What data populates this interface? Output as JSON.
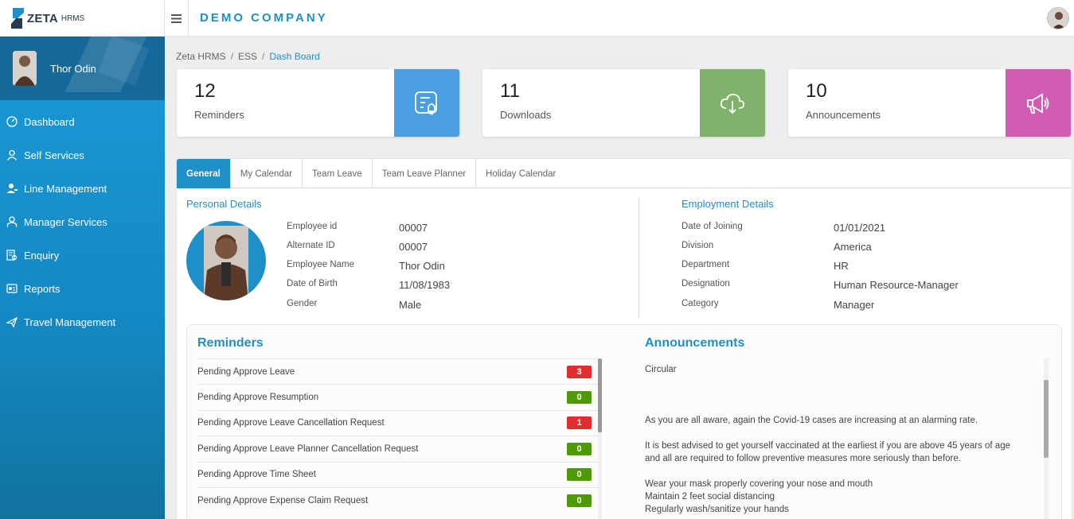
{
  "brand": {
    "name": "ZETA",
    "sub": "HRMS"
  },
  "header": {
    "company": "DEMO COMPANY"
  },
  "profile": {
    "name": "Thor Odin"
  },
  "sidebar": {
    "items": [
      {
        "label": "Dashboard",
        "icon": "dashboard-icon"
      },
      {
        "label": "Self Services",
        "icon": "user-icon"
      },
      {
        "label": "Line Management",
        "icon": "user-edit-icon"
      },
      {
        "label": "Manager Services",
        "icon": "manager-icon"
      },
      {
        "label": "Enquiry",
        "icon": "enquiry-icon"
      },
      {
        "label": "Reports",
        "icon": "reports-icon"
      },
      {
        "label": "Travel Management",
        "icon": "plane-icon"
      }
    ]
  },
  "breadcrumb": {
    "items": [
      "Zeta HRMS",
      "ESS",
      "Dash Board"
    ]
  },
  "cards": [
    {
      "count": "12",
      "label": "Reminders",
      "color": "#4a9fe0",
      "icon": "reminder-bell-icon"
    },
    {
      "count": "11",
      "label": "Downloads",
      "color": "#7fb26a",
      "icon": "cloud-download-icon"
    },
    {
      "count": "10",
      "label": "Announcements",
      "color": "#d05db3",
      "icon": "megaphone-icon"
    }
  ],
  "tabs": [
    "General",
    "My Calendar",
    "Team Leave",
    "Team Leave Planner",
    "Holiday Calendar"
  ],
  "personal": {
    "title": "Personal Details",
    "fields": [
      {
        "label": "Employee id",
        "value": "00007"
      },
      {
        "label": "Alternate ID",
        "value": "00007"
      },
      {
        "label": "Employee Name",
        "value": "Thor Odin"
      },
      {
        "label": "Date of Birth",
        "value": "11/08/1983"
      },
      {
        "label": "Gender",
        "value": "Male"
      }
    ]
  },
  "employment": {
    "title": "Employment Details",
    "fields": [
      {
        "label": "Date of Joining",
        "value": "01/01/2021"
      },
      {
        "label": "Division",
        "value": "America"
      },
      {
        "label": "Department",
        "value": "HR"
      },
      {
        "label": "Designation",
        "value": "Human Resource-Manager"
      },
      {
        "label": "Category",
        "value": "Manager"
      }
    ]
  },
  "reminders": {
    "title": "Reminders",
    "items": [
      {
        "label": "Pending Approve Leave",
        "count": "3",
        "status": "red"
      },
      {
        "label": "Pending Approve Resumption",
        "count": "0",
        "status": "green"
      },
      {
        "label": "Pending Approve Leave Cancellation Request",
        "count": "1",
        "status": "red"
      },
      {
        "label": "Pending Approve Leave Planner Cancellation Request",
        "count": "0",
        "status": "green"
      },
      {
        "label": "Pending Approve Time Sheet",
        "count": "0",
        "status": "green"
      },
      {
        "label": "Pending Approve Expense Claim Request",
        "count": "0",
        "status": "green"
      }
    ]
  },
  "announcements": {
    "title": "Announcements",
    "heading": "Circular",
    "p1": "As you are all aware, again the Covid-19 cases are increasing at an alarming rate.",
    "p2": "It is best advised to get yourself vaccinated at the earliest if you are above 45 years of age and all are required to follow preventive measures more seriously than before.",
    "l1": "Wear your mask properly covering your nose and mouth",
    "l2": "Maintain 2 feet social distancing",
    "l3": "Regularly wash/sanitize your hands"
  }
}
